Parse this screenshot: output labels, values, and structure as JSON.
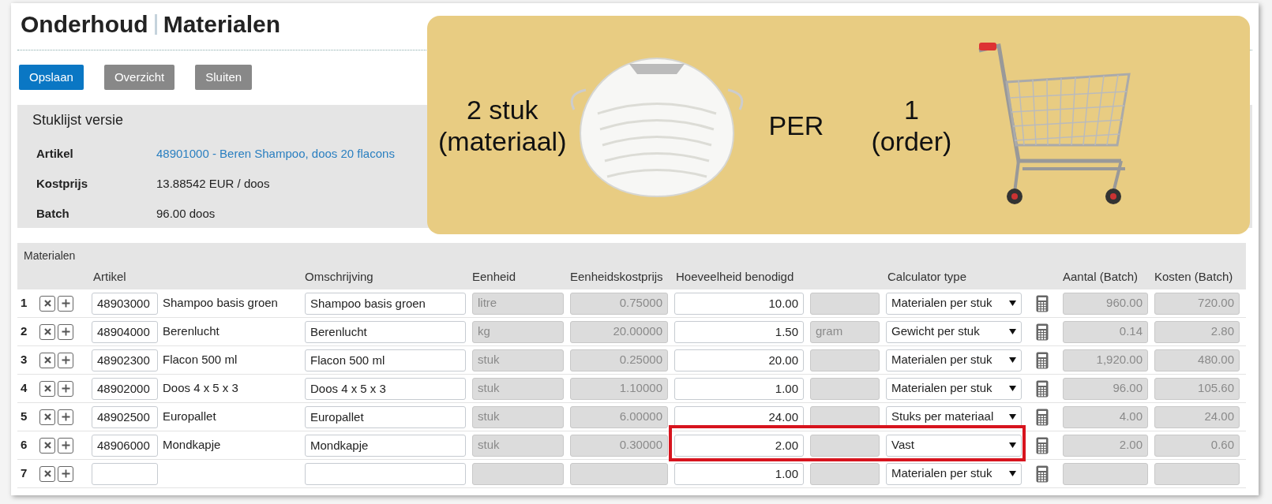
{
  "title": {
    "section": "Onderhoud",
    "page": "Materialen"
  },
  "buttons": [
    {
      "label": "Opslaan",
      "kind": "primary"
    },
    {
      "label": "Overzicht",
      "kind": "secondary"
    },
    {
      "label": "Sluiten",
      "kind": "secondary"
    }
  ],
  "info": {
    "heading": "Stuklijst versie",
    "fields": [
      {
        "label": "Artikel",
        "value": "48901000 - Beren Shampoo, doos 20 flacons",
        "kind": "link"
      },
      {
        "label": "Kostprijs",
        "value": "13.88542 EUR / doos",
        "kind": "text"
      },
      {
        "label": "Batch",
        "value": "96.00 doos",
        "kind": "text"
      }
    ]
  },
  "banner": {
    "left": "2 stuk\n(materiaal)",
    "middle": "PER",
    "right": "1\n(order)"
  },
  "table": {
    "title": "Materialen",
    "columns": [
      "Artikel",
      "Omschrijving",
      "Eenheid",
      "Eenheidskostprijs",
      "Hoeveelheid benodigd",
      "Calculator type",
      "Aantal (Batch)",
      "Kosten (Batch)"
    ],
    "rows": [
      {
        "num": "1",
        "artikel": "48903000",
        "name": "Shampoo basis groen",
        "omschrijving": "Shampoo basis groen",
        "eenheid": "litre",
        "kostprijs": "0.75000",
        "hoeveelheid": "10.00",
        "unit": "",
        "calc": "Materialen per stuk",
        "aantal": "960.00",
        "kosten": "720.00",
        "highlighted": false
      },
      {
        "num": "2",
        "artikel": "48904000",
        "name": "Berenlucht",
        "omschrijving": "Berenlucht",
        "eenheid": "kg",
        "kostprijs": "20.00000",
        "hoeveelheid": "1.50",
        "unit": "gram",
        "calc": "Gewicht per stuk",
        "aantal": "0.14",
        "kosten": "2.80",
        "highlighted": false
      },
      {
        "num": "3",
        "artikel": "48902300",
        "name": "Flacon 500 ml",
        "omschrijving": "Flacon 500 ml",
        "eenheid": "stuk",
        "kostprijs": "0.25000",
        "hoeveelheid": "20.00",
        "unit": "",
        "calc": "Materialen per stuk",
        "aantal": "1,920.00",
        "kosten": "480.00",
        "highlighted": false
      },
      {
        "num": "4",
        "artikel": "48902000",
        "name": "Doos 4 x 5 x 3",
        "omschrijving": "Doos 4 x 5 x 3",
        "eenheid": "stuk",
        "kostprijs": "1.10000",
        "hoeveelheid": "1.00",
        "unit": "",
        "calc": "Materialen per stuk",
        "aantal": "96.00",
        "kosten": "105.60",
        "highlighted": false
      },
      {
        "num": "5",
        "artikel": "48902500",
        "name": "Europallet",
        "omschrijving": "Europallet",
        "eenheid": "stuk",
        "kostprijs": "6.00000",
        "hoeveelheid": "24.00",
        "unit": "",
        "calc": "Stuks per materiaal",
        "aantal": "4.00",
        "kosten": "24.00",
        "highlighted": false
      },
      {
        "num": "6",
        "artikel": "48906000",
        "name": "Mondkapje",
        "omschrijving": "Mondkapje",
        "eenheid": "stuk",
        "kostprijs": "0.30000",
        "hoeveelheid": "2.00",
        "unit": "",
        "calc": "Vast",
        "aantal": "2.00",
        "kosten": "0.60",
        "highlighted": true
      },
      {
        "num": "7",
        "artikel": "",
        "name": "",
        "omschrijving": "",
        "eenheid": "",
        "kostprijs": "",
        "hoeveelheid": "1.00",
        "unit": "",
        "calc": "Materialen per stuk",
        "aantal": "",
        "kosten": "",
        "highlighted": false
      }
    ]
  }
}
